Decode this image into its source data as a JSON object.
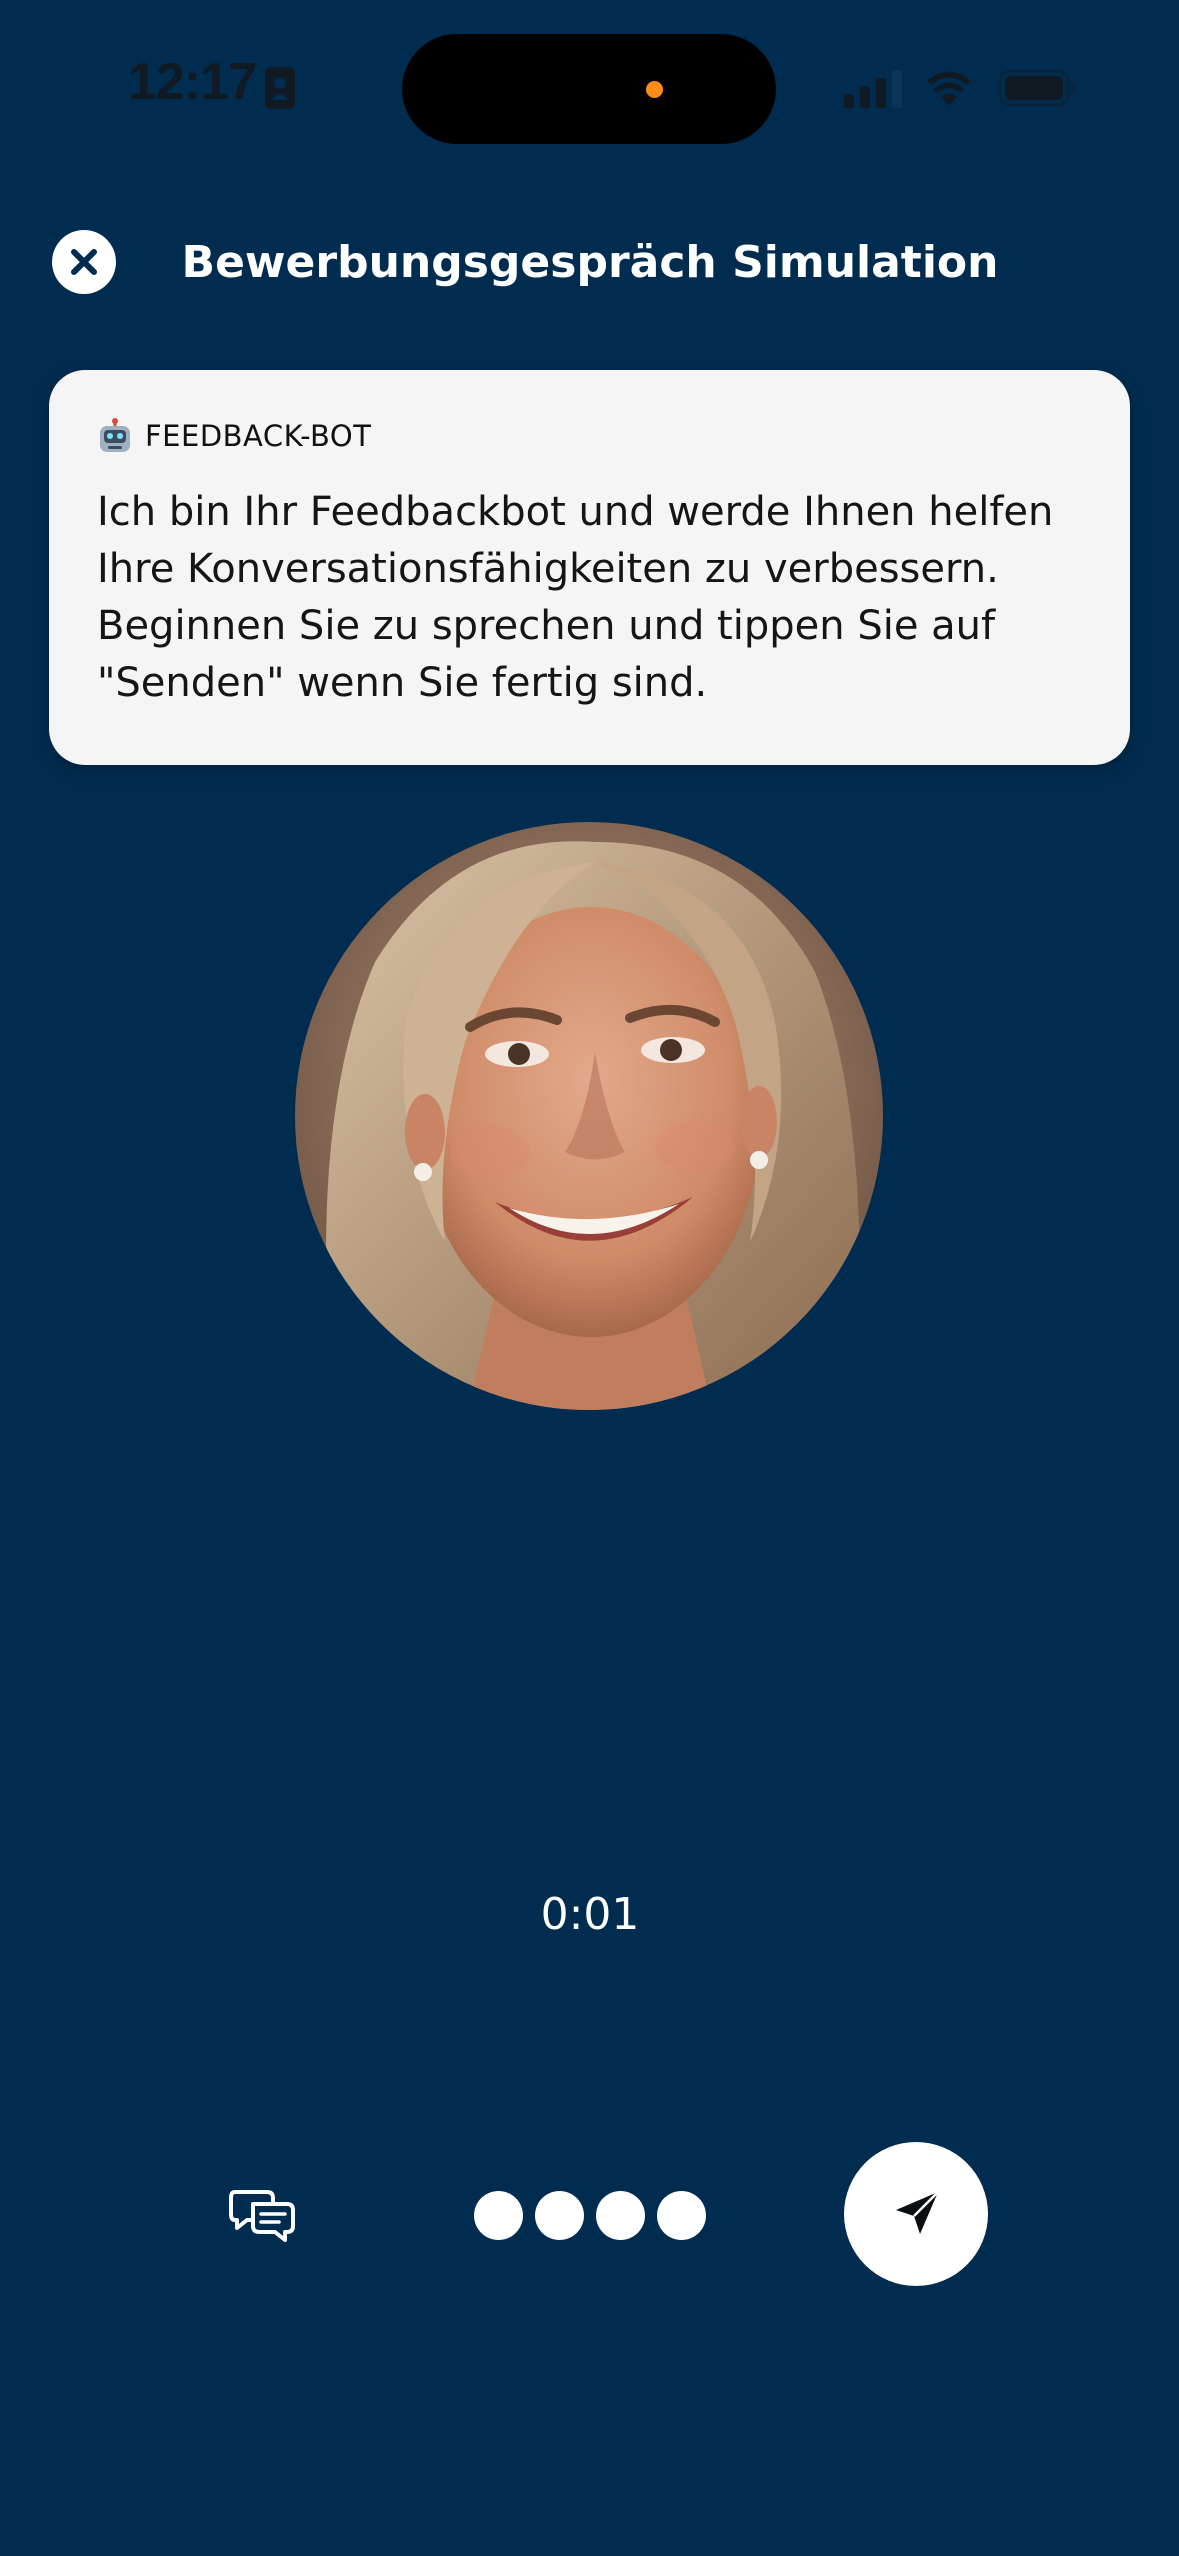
{
  "status_bar": {
    "time": "12:17"
  },
  "header": {
    "title": "Bewerbungsgespräch Simulation",
    "close_icon": "close-icon"
  },
  "feedback": {
    "label": "FEEDBACK-BOT",
    "icon": "robot-icon",
    "message": "Ich bin Ihr Feedbackbot und werde Ihnen helfen Ihre Konversationsfähigkeiten zu verbessern. Beginnen Sie zu sprechen und tippen Sie auf \"Senden\" wenn Sie fertig sind."
  },
  "timer": {
    "value": "0:01"
  },
  "controls": {
    "chat_icon": "chat-bubbles-icon",
    "send_icon": "send-icon",
    "audio_dots": 4
  },
  "colors": {
    "background": "#002c4f",
    "card": "#f5f5f5",
    "accent": "#ffffff",
    "recording_dot": "#ff8c1a"
  }
}
